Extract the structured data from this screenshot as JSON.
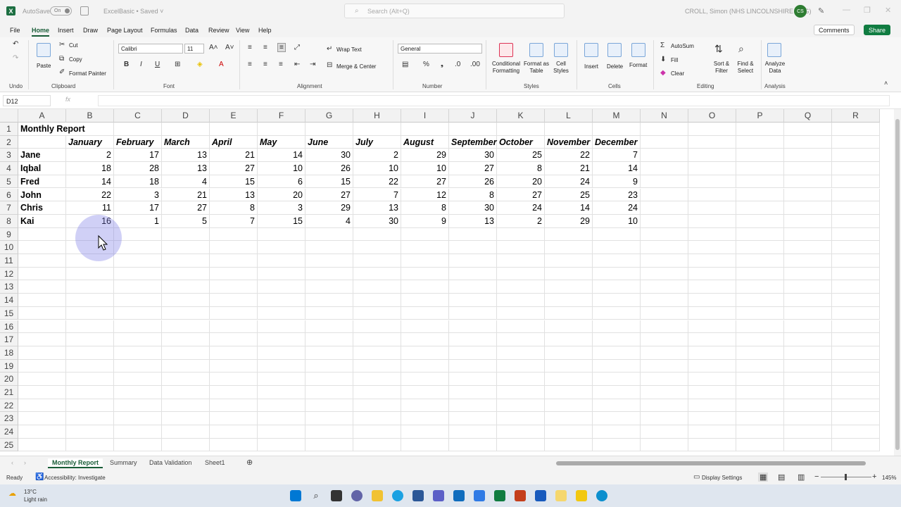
{
  "title_bar": {
    "autosave_label": "AutoSave",
    "autosave_toggle": "On",
    "file_name": "ExcelBasic • Saved ˅",
    "search_placeholder": "Search (Alt+Q)",
    "user_name": "CROLL, Simon (NHS LINCOLNSHIRE CCG)",
    "user_initials": "CS"
  },
  "menu": {
    "tabs": [
      "File",
      "Home",
      "Insert",
      "Draw",
      "Page Layout",
      "Formulas",
      "Data",
      "Review",
      "View",
      "Help"
    ],
    "active_tab": "Home",
    "comments_label": "Comments",
    "share_label": "Share"
  },
  "ribbon": {
    "undo_label": "Undo",
    "clipboard": {
      "paste": "Paste",
      "cut": "Cut",
      "copy": "Copy",
      "format_painter": "Format Painter",
      "group": "Clipboard"
    },
    "font": {
      "name": "Calibri",
      "size": "11",
      "group": "Font"
    },
    "alignment": {
      "wrap_text": "Wrap Text",
      "merge_center": "Merge & Center",
      "group": "Alignment"
    },
    "number": {
      "format": "General",
      "group": "Number"
    },
    "styles": {
      "conditional": "Conditional Formatting",
      "format_table": "Format as Table",
      "cell_styles": "Cell Styles",
      "group": "Styles"
    },
    "cells": {
      "insert": "Insert",
      "delete": "Delete",
      "format": "Format",
      "group": "Cells"
    },
    "editing": {
      "autosum": "AutoSum",
      "fill": "Fill",
      "clear": "Clear",
      "sort_filter": "Sort & Filter",
      "find_select": "Find & Select",
      "group": "Editing"
    },
    "analysis": {
      "analyze": "Analyze Data",
      "group": "Analysis"
    }
  },
  "formula_bar": {
    "name_box": "D12",
    "fx": "fx",
    "value": ""
  },
  "columns": [
    "A",
    "B",
    "C",
    "D",
    "E",
    "F",
    "G",
    "H",
    "I",
    "J",
    "K",
    "L",
    "M",
    "N",
    "O",
    "P",
    "Q",
    "R"
  ],
  "rows": [
    "1",
    "2",
    "3",
    "4",
    "5",
    "6",
    "7",
    "8",
    "9",
    "10",
    "11",
    "12",
    "13",
    "14",
    "15",
    "16",
    "17",
    "18",
    "19",
    "20",
    "21",
    "22",
    "23",
    "24",
    "25"
  ],
  "sheet": {
    "title": "Monthly Report",
    "months": [
      "January",
      "February",
      "March",
      "April",
      "May",
      "June",
      "July",
      "August",
      "September",
      "October",
      "November",
      "December"
    ],
    "people": [
      {
        "name": "Jane",
        "values": [
          "2",
          "17",
          "13",
          "21",
          "14",
          "30",
          "2",
          "29",
          "30",
          "25",
          "22",
          "7"
        ]
      },
      {
        "name": "Iqbal",
        "values": [
          "18",
          "28",
          "13",
          "27",
          "10",
          "26",
          "10",
          "10",
          "27",
          "8",
          "21",
          "14"
        ]
      },
      {
        "name": "Fred",
        "values": [
          "14",
          "18",
          "4",
          "15",
          "6",
          "15",
          "22",
          "27",
          "26",
          "20",
          "24",
          "9"
        ]
      },
      {
        "name": "John",
        "values": [
          "22",
          "3",
          "21",
          "13",
          "20",
          "27",
          "7",
          "12",
          "8",
          "27",
          "25",
          "23"
        ]
      },
      {
        "name": "Chris",
        "values": [
          "11",
          "17",
          "27",
          "8",
          "3",
          "29",
          "13",
          "8",
          "30",
          "24",
          "14",
          "24"
        ]
      },
      {
        "name": "Kai",
        "values": [
          "16",
          "1",
          "5",
          "7",
          "15",
          "4",
          "30",
          "9",
          "13",
          "2",
          "29",
          "10"
        ]
      }
    ]
  },
  "sheet_tabs": [
    "Monthly Report",
    "Summary",
    "Data Validation",
    "Sheet1"
  ],
  "active_sheet": "Monthly Report",
  "status": {
    "ready": "Ready",
    "accessibility": "Accessibility: Investigate",
    "display_settings": "Display Settings",
    "zoom": "145%"
  },
  "taskbar": {
    "temperature": "13°C",
    "weather": "Light rain"
  },
  "colors": {
    "accent": "#107c41",
    "brand": "#1d6f42"
  }
}
